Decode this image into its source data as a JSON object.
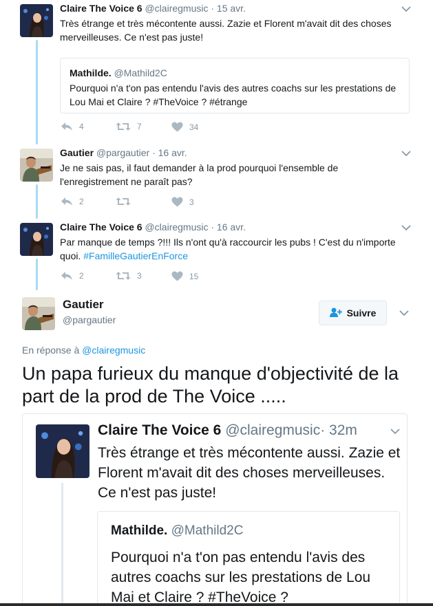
{
  "thread": [
    {
      "name": "Claire The Voice 6",
      "handle": "@clairegmusic",
      "time": "· 15 avr.",
      "text": "Très étrange et très mécontente aussi. Zazie et Florent m'avait dit des choses merveilleuses. Ce n'est pas juste!",
      "quote": {
        "name": "Mathilde.",
        "handle": "@Mathild2C",
        "text": "Pourquoi n'a t'on pas entendu l'avis des autres coachs sur les prestations de Lou Mai et Claire ? #TheVoice ? #étrange"
      },
      "replies": "4",
      "retweets": "7",
      "likes": "34"
    },
    {
      "name": "Gautier",
      "handle": "@pargautier",
      "time": "· 16 avr.",
      "text": "Je ne sais pas, il faut demander à la prod pourquoi l'ensemble de l'enregistrement ne paraît pas?",
      "replies": "2",
      "retweets": "",
      "likes": "3"
    },
    {
      "name": "Claire The Voice 6",
      "handle": "@clairegmusic",
      "time": "· 16 avr.",
      "text": "Par manque de temps ?!!! Ils n'ont qu'à raccourcir les pubs ! C'est du n'importe quoi.",
      "hashtag": "#FamilleGautierEnForce",
      "replies": "2",
      "retweets": "3",
      "likes": "15"
    }
  ],
  "main": {
    "name": "Gautier",
    "handle": "@pargautier",
    "follow_label": "Suivre",
    "reply_prefix": "En réponse à",
    "reply_mention": "@clairegmusic",
    "text": "Un papa furieux du manque d'objectivité de la part de la prod de The Voice .....",
    "embed": {
      "name": "Claire The Voice 6",
      "handle": "@clairegmusic",
      "time": "· 32m",
      "text": "Très étrange et très mécontente aussi. Zazie et Florent m'avait dit des choses merveilleuses. Ce n'est pas juste!",
      "quote": {
        "name": "Mathilde.",
        "handle": "@Mathild2C",
        "text": "Pourquoi n'a t'on pas entendu l'avis des autres coachs sur les prestations de Lou Mai et Claire ? #TheVoice ?"
      }
    }
  },
  "colors": {
    "link": "#1b95e0",
    "muted": "#657786",
    "thread_line": "#a7dbf4",
    "border": "#e1e8ed"
  },
  "icons": [
    "chevron-down-icon",
    "reply-icon",
    "retweet-icon",
    "heart-icon",
    "follow-icon"
  ]
}
